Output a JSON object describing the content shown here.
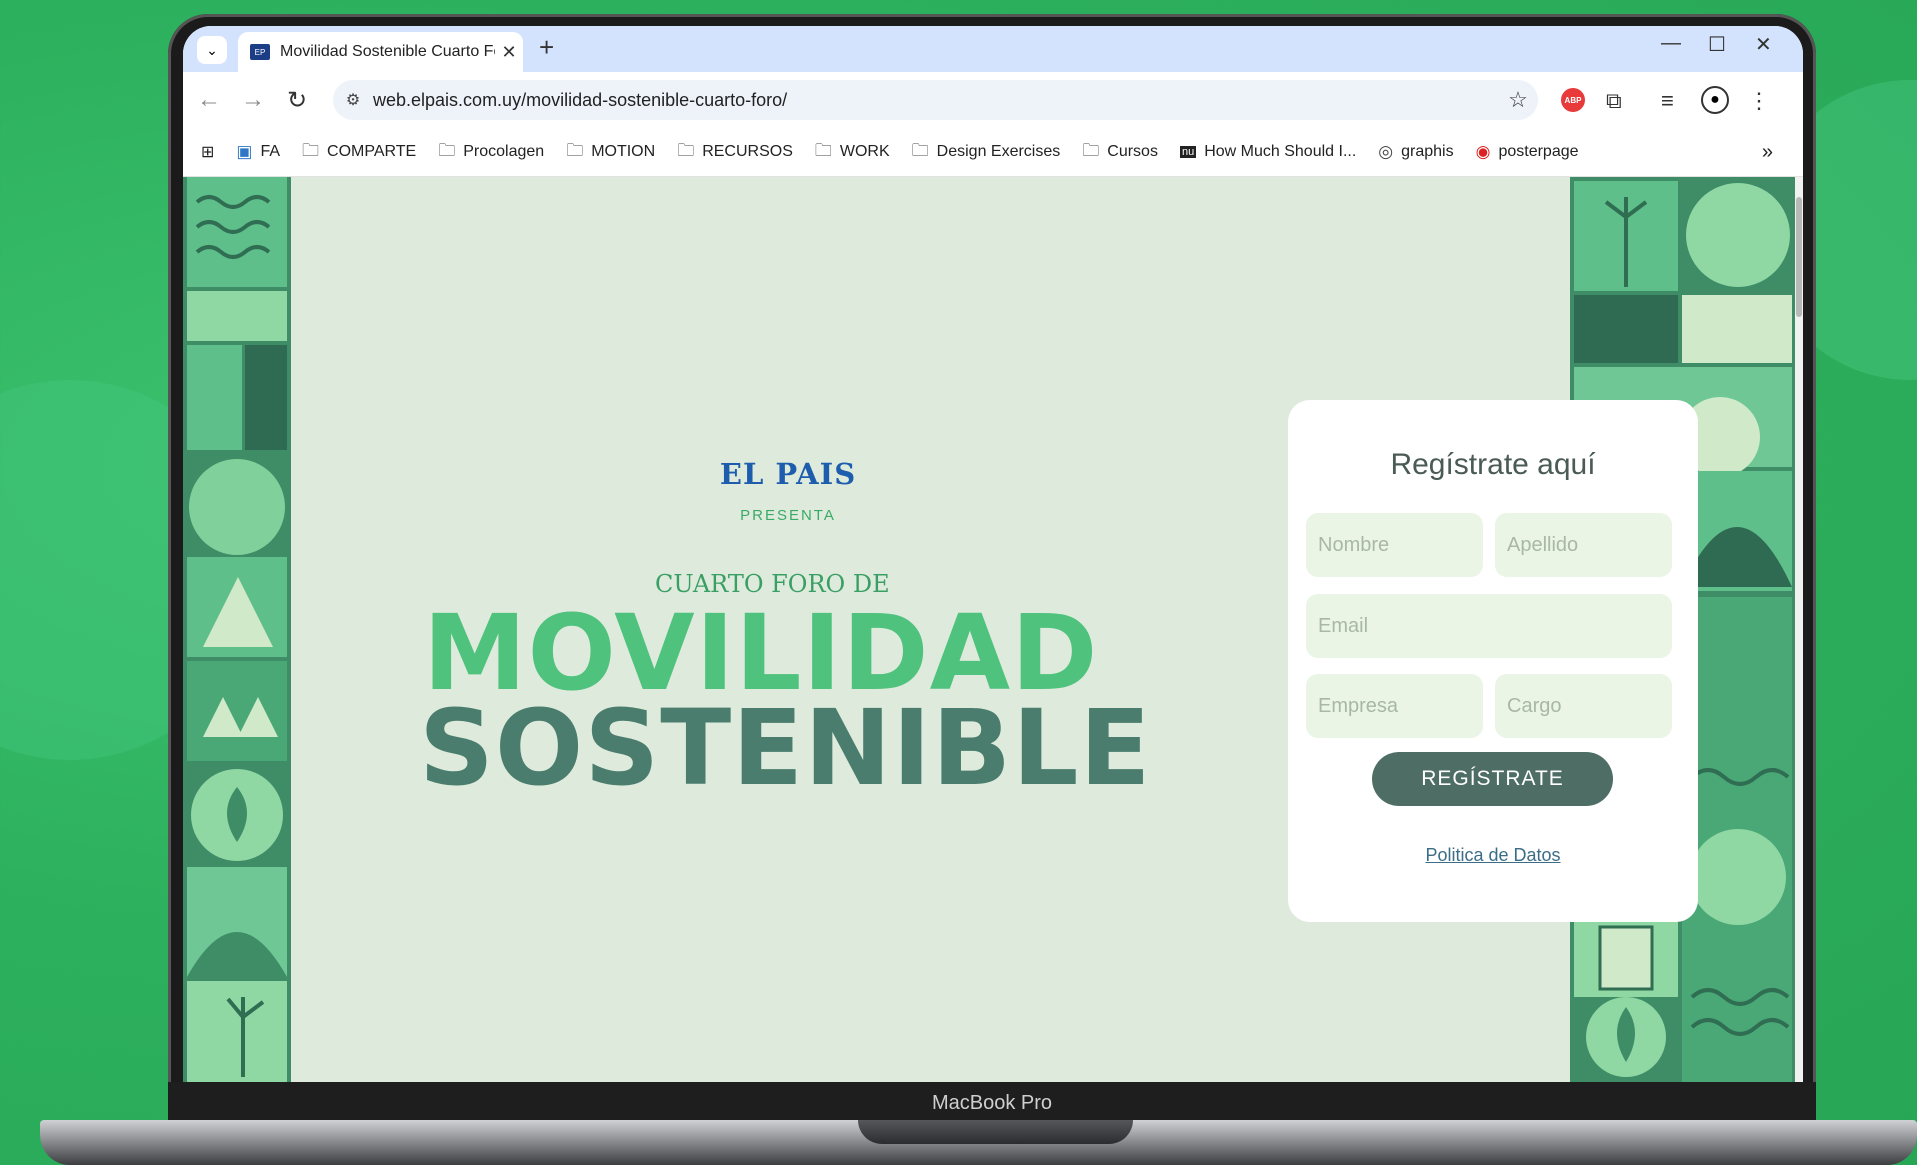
{
  "browser": {
    "tab_title": "Movilidad Sostenible Cuarto Fo",
    "favicon_text": "EP",
    "url": "web.elpais.com.uy/movilidad-sostenible-cuarto-foro/",
    "bookmarks": [
      "FA",
      "COMPARTE",
      "Procolagen",
      "MOTION",
      "RECURSOS",
      "WORK",
      "Design Exercises",
      "Cursos",
      "How Much Should I...",
      "graphis",
      "posterpage"
    ]
  },
  "page": {
    "brand": "EL PAIS",
    "presenta": "PRESENTA",
    "subtitle": "CUARTO FORO DE",
    "logo_line1": "MOVILIDAD",
    "logo_line2": "SOSTENIBLE"
  },
  "form": {
    "title": "Regístrate aquí",
    "nombre_placeholder": "Nombre",
    "apellido_placeholder": "Apellido",
    "email_placeholder": "Email",
    "empresa_placeholder": "Empresa",
    "cargo_placeholder": "Cargo",
    "submit_label": "REGÍSTRATE",
    "policy_link": "Politica de Datos"
  },
  "device": {
    "label": "MacBook Pro"
  },
  "colors": {
    "background": "#2db15e",
    "page_bg": "#deebdc",
    "brand_blue": "#1e5dad",
    "logo_green": "#4fc27e",
    "logo_dark": "#4b7d6e",
    "button": "#4e6e65"
  }
}
